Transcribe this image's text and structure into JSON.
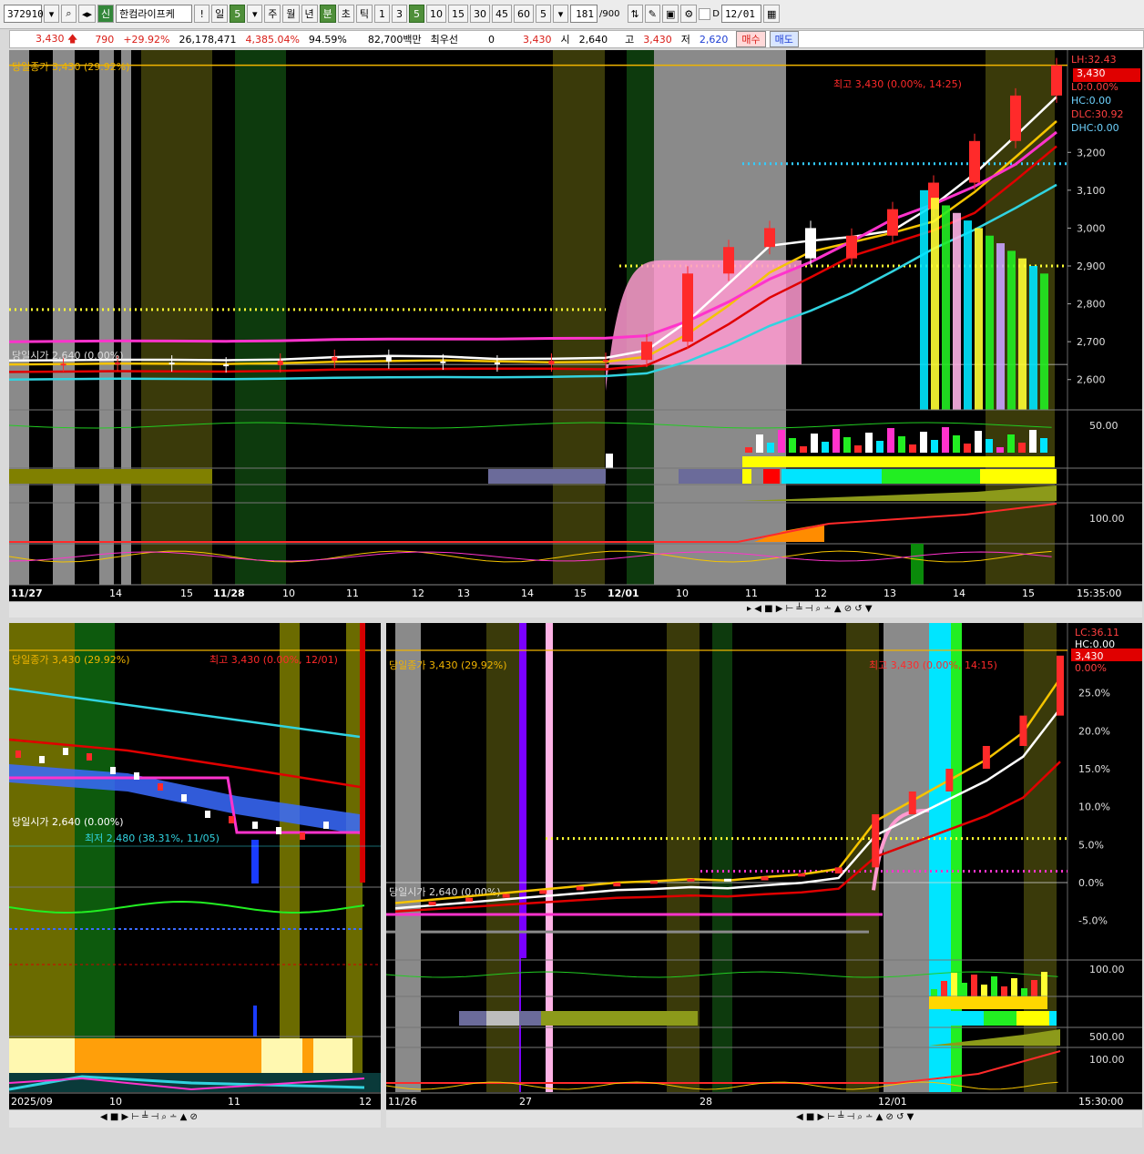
{
  "toolbar": {
    "code": "372910",
    "market_badge": "신",
    "name": "한컴라이프케",
    "excl": "!",
    "period_day": "일",
    "period_num": "5",
    "period_week": "주",
    "period_month": "월",
    "period_year": "년",
    "period_min": "분",
    "period_sec": "초",
    "period_tick": "틱",
    "interval_buttons": [
      "1",
      "3",
      "5",
      "10",
      "15",
      "30",
      "45",
      "60"
    ],
    "interval_value": "5",
    "count": "181",
    "count_total": "/900",
    "d_label": "D",
    "date": "12/01"
  },
  "quote": {
    "price": "3,430",
    "change": "790",
    "change_pct": "+29.92%",
    "volume": "26,178,471",
    "vol_ratio": "4,385.04%",
    "turnover": "94.59%",
    "amount": "82,700백만",
    "pref_label": "최우선",
    "pref_value": "0",
    "pref_price": "3,430",
    "open_label": "시",
    "open": "2,640",
    "high_label": "고",
    "high": "3,430",
    "low_label": "저",
    "low": "2,620",
    "buy_label": "매수",
    "sell_label": "매도"
  },
  "top_chart": {
    "close_label": "당일종가 3,430 (29.92%)",
    "open_label": "당일시가 2,640 (0.00%)",
    "high_label": "최고 3,430 (0.00%, 14:25)",
    "right_info": [
      "LH:32.43",
      "3,430",
      "L0:0.00%",
      "HC:0.00",
      "DLC:30.92",
      "DHC:0.00"
    ],
    "indicator_label_1": "50.00",
    "indicator_label_2": "100.00",
    "time_label": "15:35:00",
    "x_ticks": [
      "11/27",
      "14",
      "15",
      "11/28",
      "10",
      "11",
      "12",
      "13",
      "14",
      "15",
      "12/01",
      "10",
      "11",
      "12",
      "13",
      "14",
      "15"
    ]
  },
  "bottom_left_chart": {
    "close_label": "당일종가 3,430 (29.92%)",
    "high_label": "최고 3,430 (0.00%, 12/01)",
    "open_label": "당일시가 2,640 (0.00%)",
    "low_label": "최저 2,480 (38.31%, 11/05)",
    "x_ticks": [
      "2025/09",
      "10",
      "11",
      "12"
    ]
  },
  "bottom_right_chart": {
    "close_label": "당일종가 3,430 (29.92%)",
    "open_label": "당일시가 2,640 (0.00%)",
    "high_label": "최고 3,430 (0.00%, 14:15)",
    "right_info": [
      "LC:36.11",
      "HC:0.00",
      "3,430",
      "0.00%"
    ],
    "indicator_label_1": "100.00",
    "indicator_label_2": "500.00",
    "indicator_label_3": "100.00",
    "time_label": "15:30:00",
    "x_ticks": [
      "11/26",
      "27",
      "28",
      "12/01"
    ]
  },
  "chart_data": [
    {
      "type": "line",
      "title": "",
      "xlabel": "",
      "ylabel": "",
      "y_ticks": [
        2600,
        2700,
        2800,
        2900,
        3000,
        3100,
        3200
      ],
      "ylim": [
        2520,
        3470
      ],
      "series": [
        {
          "values": [
            2640,
            2642,
            2645,
            2640,
            2638,
            2650,
            2660,
            2648,
            2645,
            2640,
            2650,
            2652,
            2700,
            2880,
            2950,
            3000,
            2920,
            2980,
            3050,
            3120,
            3230,
            3350,
            3430
          ]
        }
      ],
      "colors": {
        "price_up": "#ff2a2a",
        "price_down": "#ffffff",
        "ma_red": "#e00000",
        "ma_white": "#ffffff",
        "ma_cyan": "#31d3e0",
        "ma_yellow": "#f5c400",
        "ma_magenta": "#ff33cc",
        "ma_pink": "#ff9ad0",
        "level_line": "#f0b400"
      }
    },
    {
      "type": "line",
      "title": "",
      "x_ticks": [
        "2025/09",
        "10",
        "11",
        "12"
      ],
      "series": [
        {
          "values": [
            2780,
            2760,
            2790,
            2770,
            2720,
            2700,
            2660,
            2620,
            2560,
            2540,
            2520,
            2500,
            2480,
            2520,
            3430
          ]
        }
      ]
    },
    {
      "type": "line",
      "title": "",
      "y_ticks": [
        "25.0%",
        "20.0%",
        "15.0%",
        "10.0%",
        "5.0%",
        "0.0%",
        "-5.0%"
      ],
      "x_ticks": [
        "11/26",
        "27",
        "28",
        "12/01"
      ],
      "series": [
        {
          "values": [
            -3,
            -2.5,
            -2,
            -1.5,
            -1,
            -0.5,
            0,
            0.2,
            0.5,
            0.3,
            0.8,
            1.2,
            2,
            9,
            12,
            15,
            18,
            22,
            29.9
          ]
        }
      ]
    }
  ]
}
